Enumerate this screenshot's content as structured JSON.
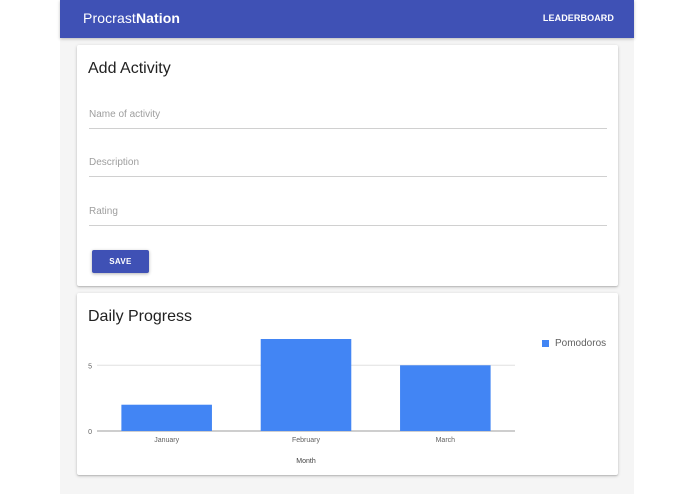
{
  "appbar": {
    "brand_prefix": "Procrast",
    "brand_suffix": "Nation",
    "nav_leaderboard": "LEADERBOARD",
    "color": "#3f51b5"
  },
  "add_activity": {
    "title": "Add Activity",
    "name_placeholder": "Name of activity",
    "description_placeholder": "Description",
    "rating_placeholder": "Rating",
    "save_label": "SAVE"
  },
  "daily_progress": {
    "title": "Daily Progress"
  },
  "chart_data": {
    "type": "bar",
    "categories": [
      "January",
      "February",
      "March"
    ],
    "series": [
      {
        "name": "Pomodoros",
        "values": [
          2,
          7,
          5
        ],
        "color": "#4285f4"
      }
    ],
    "xlabel": "Month",
    "ylabel": "",
    "ylim": [
      0,
      7
    ],
    "yticks": [
      "0",
      "5"
    ],
    "grid": true,
    "legend": "top-right"
  }
}
